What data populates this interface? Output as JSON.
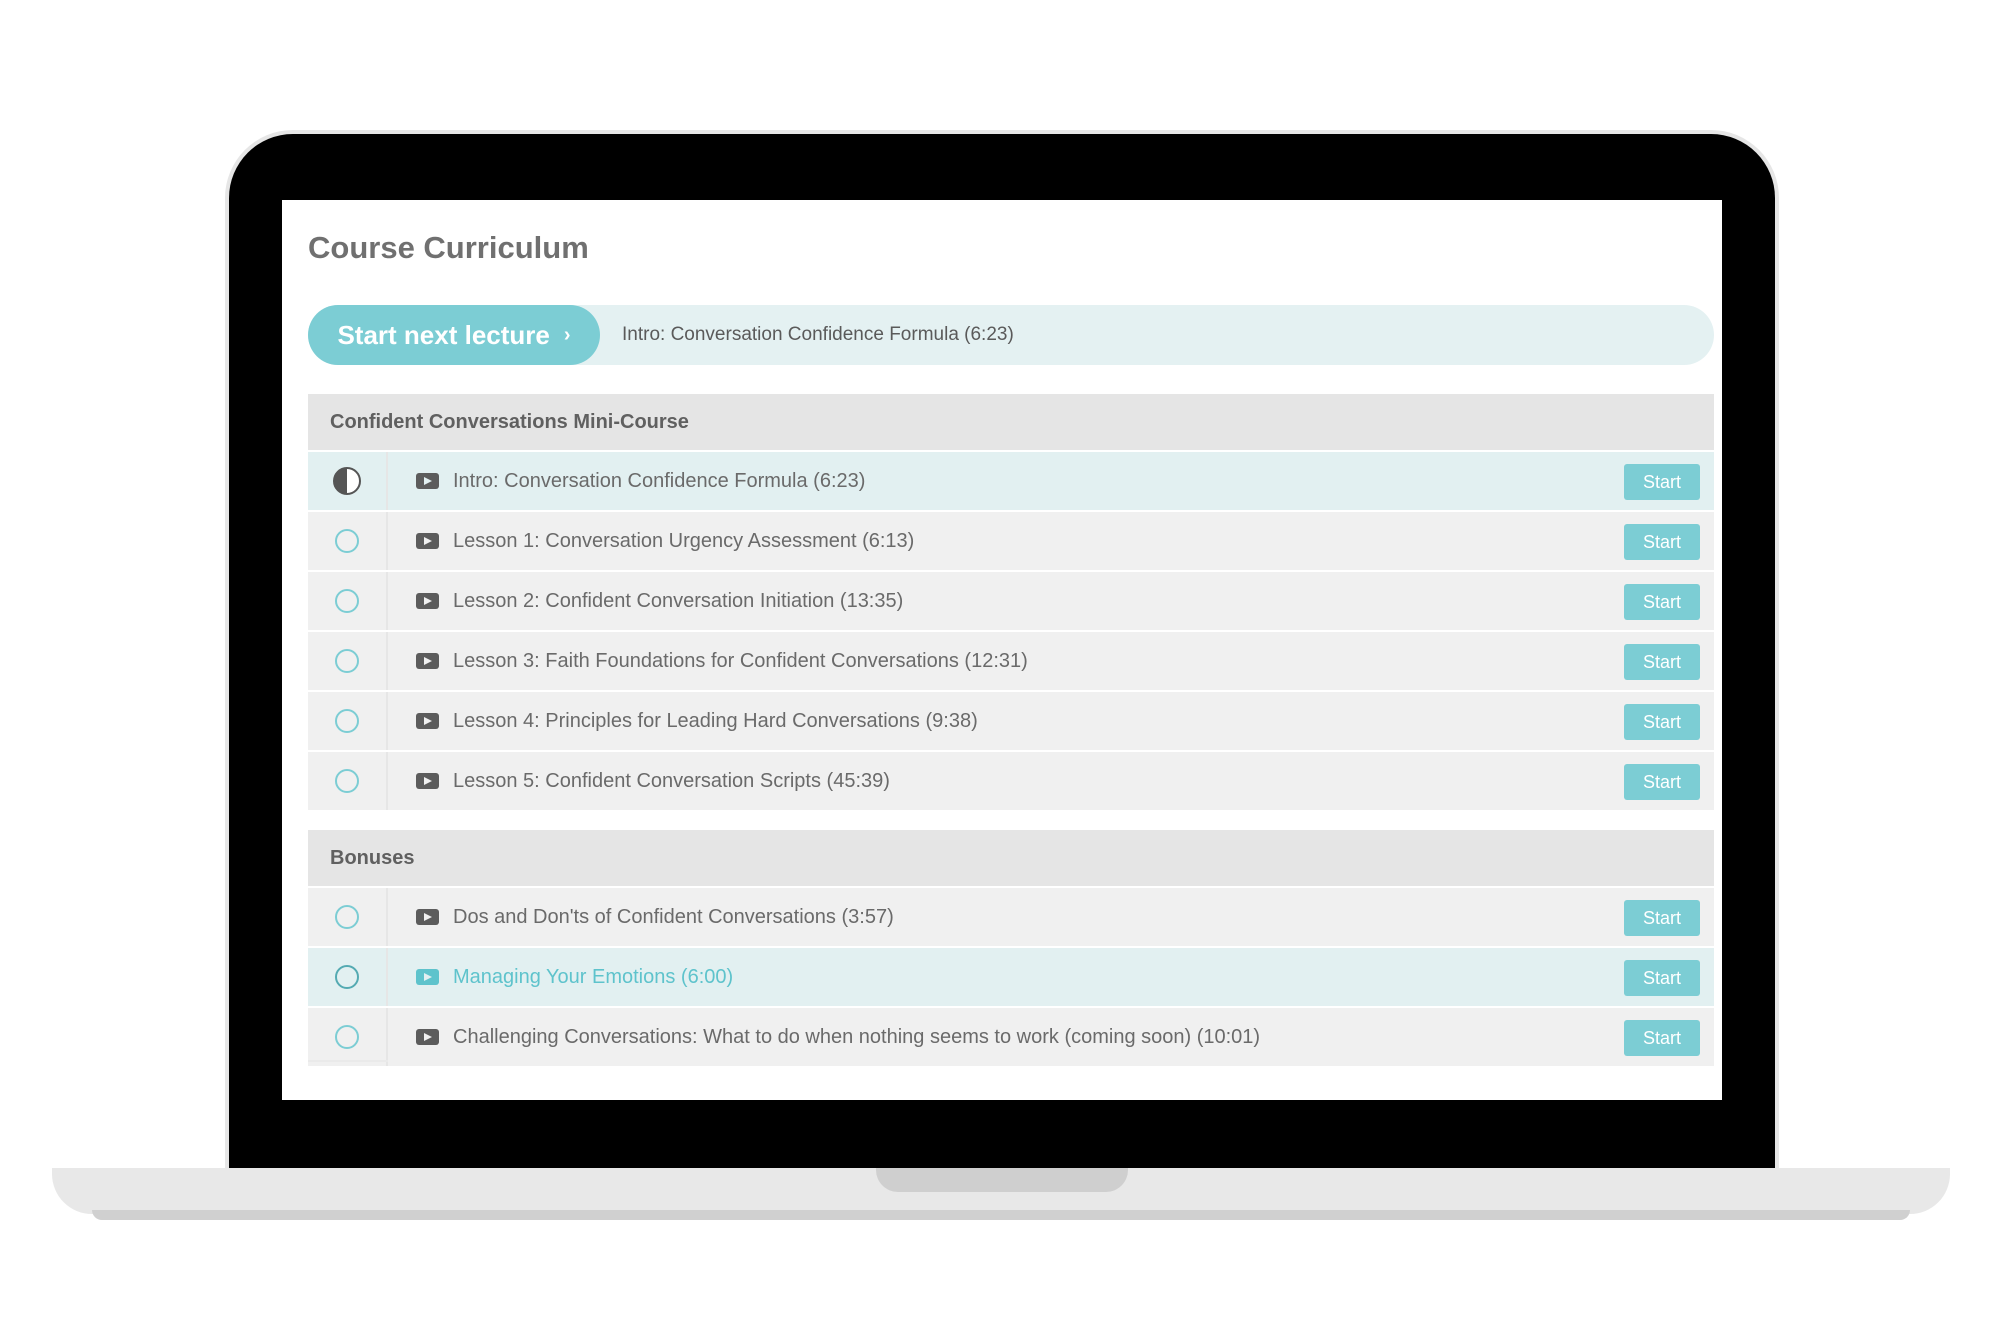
{
  "page": {
    "title": "Course Curriculum"
  },
  "next_lecture": {
    "button_label": "Start next lecture",
    "chevron": "›",
    "lecture_title": "Intro: Conversation Confidence Formula (6:23)"
  },
  "sections": [
    {
      "title": "Confident Conversations Mini-Course",
      "lectures": [
        {
          "title": "Intro: Conversation Confidence Formula (6:23)",
          "status": "in-progress",
          "button": "Start"
        },
        {
          "title": "Lesson 1: Conversation Urgency Assessment (6:13)",
          "status": "not-started",
          "button": "Start"
        },
        {
          "title": "Lesson 2: Confident Conversation Initiation (13:35)",
          "status": "not-started",
          "button": "Start"
        },
        {
          "title": "Lesson 3: Faith Foundations for Confident Conversations (12:31)",
          "status": "not-started",
          "button": "Start"
        },
        {
          "title": "Lesson 4: Principles for Leading Hard Conversations (9:38)",
          "status": "not-started",
          "button": "Start"
        },
        {
          "title": "Lesson 5: Confident Conversation Scripts (45:39)",
          "status": "not-started",
          "button": "Start"
        }
      ]
    },
    {
      "title": "Bonuses",
      "lectures": [
        {
          "title": "Dos and Don'ts of Confident Conversations (3:57)",
          "status": "not-started",
          "button": "Start"
        },
        {
          "title": "Managing Your Emotions (6:00)",
          "status": "not-started",
          "button": "Start"
        },
        {
          "title": "Challenging Conversations: What to do when nothing seems to work (coming soon) (10:01)",
          "status": "not-started",
          "button": "Start"
        }
      ]
    }
  ],
  "icons": {
    "lecture": "video-icon",
    "in_progress": "half-circle-icon",
    "not_started": "empty-circle-icon"
  },
  "colors": {
    "accent": "#7ccdd4",
    "accent_text": "#5ec3cc",
    "highlight_row": "#e2f0f1",
    "row": "#f0f0f0",
    "section_header": "#e5e5e5"
  }
}
